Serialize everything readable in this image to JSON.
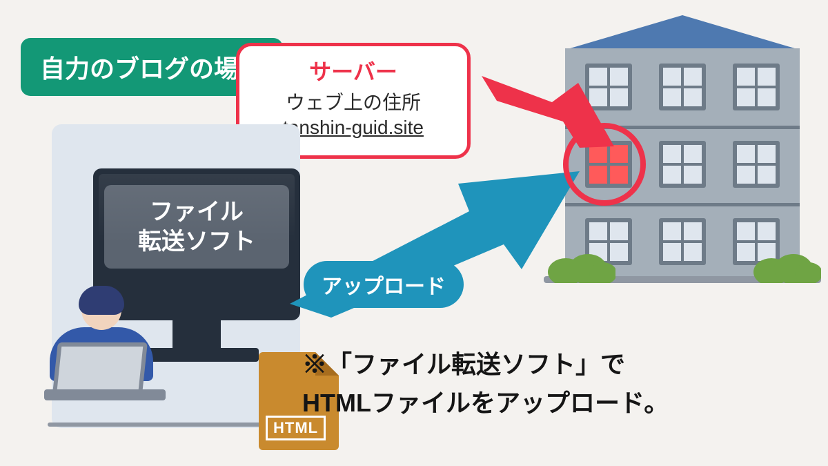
{
  "title_badge": "自力のブログの場合",
  "screen": {
    "line1": "ファイル",
    "line2": "転送ソフト"
  },
  "file_label": "HTML",
  "upload_label": "アップロード",
  "server": {
    "title": "サーバー",
    "subtitle": "ウェブ上の住所",
    "url": "tanshin-guid.site"
  },
  "caption": {
    "line1": "※「ファイル転送ソフト」で",
    "line2": "HTMLファイルをアップロード。"
  },
  "colors": {
    "badge": "#139876",
    "accent_red": "#ee324a",
    "upload_blue": "#1f94bb",
    "file_orange": "#c98a2e"
  }
}
